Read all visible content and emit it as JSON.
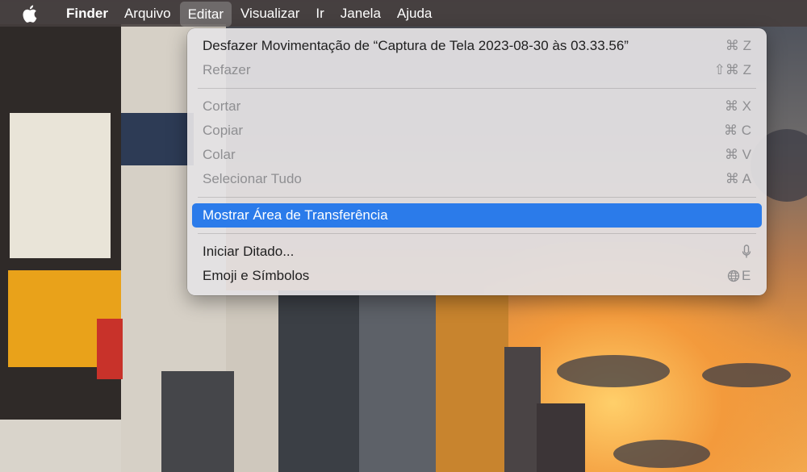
{
  "menubar": {
    "apple_icon": "apple-icon",
    "items": [
      {
        "label": "Finder",
        "bold": true
      },
      {
        "label": "Arquivo"
      },
      {
        "label": "Editar",
        "active": true
      },
      {
        "label": "Visualizar"
      },
      {
        "label": "Ir"
      },
      {
        "label": "Janela"
      },
      {
        "label": "Ajuda"
      }
    ]
  },
  "edit_menu": {
    "undo": {
      "label": "Desfazer Movimentação de “Captura de Tela 2023-08-30 às 03.33.56”",
      "shortcut": "⌘ Z"
    },
    "redo": {
      "label": "Refazer",
      "shortcut": "⇧⌘ Z"
    },
    "cut": {
      "label": "Cortar",
      "shortcut": "⌘ X"
    },
    "copy": {
      "label": "Copiar",
      "shortcut": "⌘ C"
    },
    "paste": {
      "label": "Colar",
      "shortcut": "⌘ V"
    },
    "select_all": {
      "label": "Selecionar Tudo",
      "shortcut": "⌘ A"
    },
    "show_clipboard": {
      "label": "Mostrar Área de Transferência"
    },
    "start_dictation": {
      "label": "Iniciar Ditado...",
      "shortcut_icon": "microphone-icon"
    },
    "emoji": {
      "label": "Emoji e Símbolos",
      "shortcut_icon": "globe-icon",
      "shortcut": "E"
    }
  },
  "colors": {
    "highlight": "#2b7bea",
    "disabled_text": "#8f8f92"
  }
}
